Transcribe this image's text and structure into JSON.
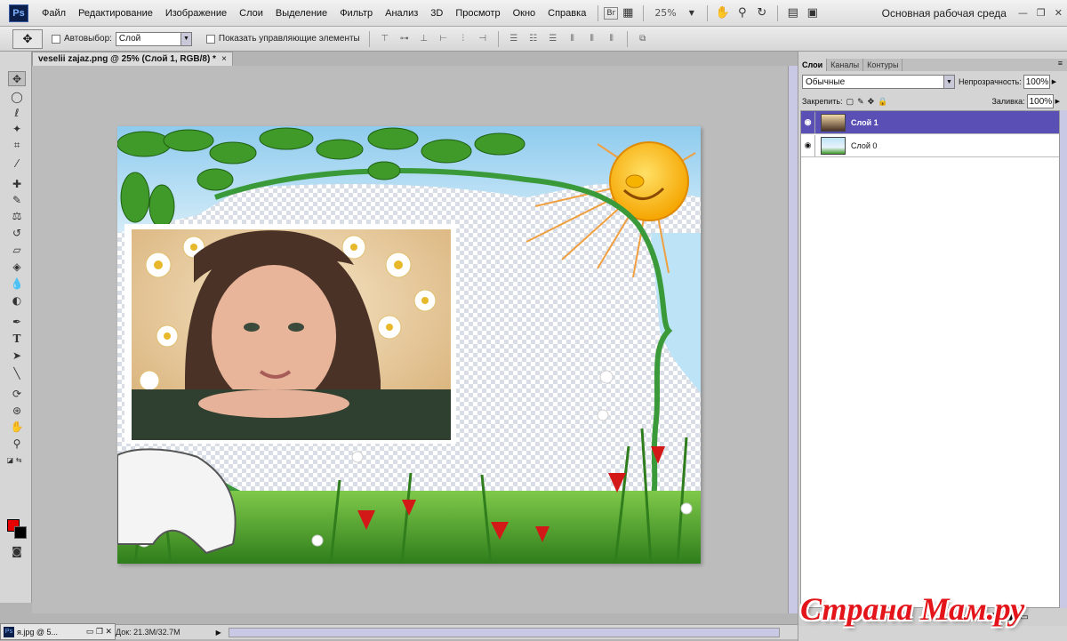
{
  "app": {
    "logo": "Ps"
  },
  "menu": [
    "Файл",
    "Редактирование",
    "Изображение",
    "Слои",
    "Выделение",
    "Фильтр",
    "Анализ",
    "3D",
    "Просмотр",
    "Окно",
    "Справка"
  ],
  "app_toolbar": {
    "zoom": "25%",
    "workspace": "Основная рабочая среда"
  },
  "options_bar": {
    "auto_select_label": "Автовыбор:",
    "auto_select_value": "Слой",
    "show_transform_label": "Показать управляющие элементы"
  },
  "document": {
    "tab_title": "veselii zajaz.png @ 25% (Слой 1, RGB/8) *",
    "close_symbol": "×"
  },
  "status": {
    "mini_doc": "я.jpg @ 5...",
    "doc_size": "Док: 21.3M/32.7M"
  },
  "layers_panel": {
    "tabs": [
      "Слои",
      "Каналы",
      "Контуры"
    ],
    "blend_mode": "Обычные",
    "opacity_label": "Непрозрачность:",
    "opacity_value": "100%",
    "lock_label": "Закрепить:",
    "fill_label": "Заливка:",
    "fill_value": "100%",
    "layers": [
      {
        "name": "Слой 1",
        "selected": true
      },
      {
        "name": "Слой 0",
        "selected": false
      }
    ]
  },
  "watermark": "Страна Мам.ру",
  "colors": {
    "foreground": "#e60000",
    "background": "#000000",
    "selection": "#5a4fb4"
  }
}
